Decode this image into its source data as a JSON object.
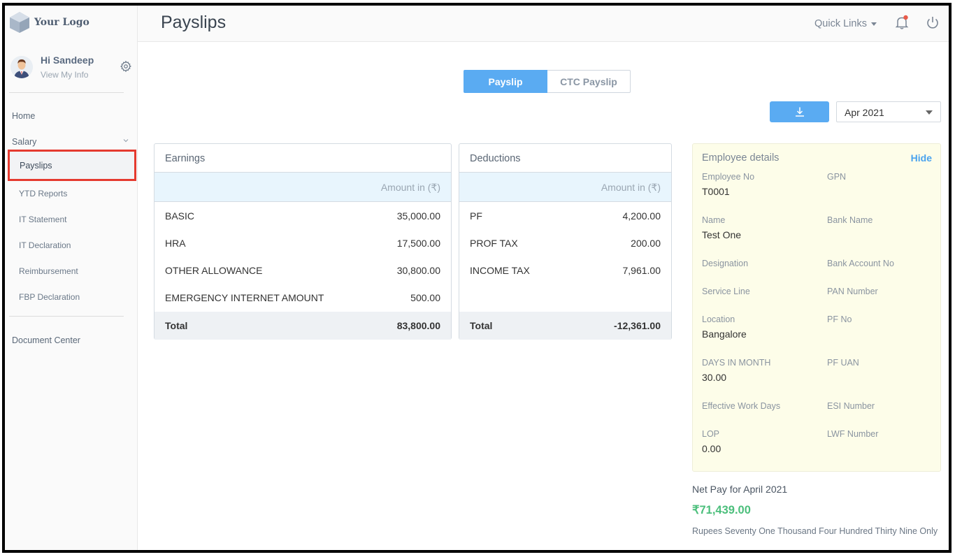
{
  "app": {
    "logo_text": "Your Logo"
  },
  "header": {
    "title": "Payslips",
    "quick_links": "Quick Links"
  },
  "profile": {
    "greeting": "Hi Sandeep",
    "view_info": "View My Info"
  },
  "nav": {
    "home": "Home",
    "salary": "Salary",
    "items": [
      "Payslips",
      "YTD Reports",
      "IT Statement",
      "IT Declaration",
      "Reimbursement",
      "FBP Declaration"
    ],
    "document_center": "Document Center"
  },
  "tabs": {
    "payslip": "Payslip",
    "ctc_payslip": "CTC Payslip"
  },
  "month_select": {
    "value": "Apr 2021"
  },
  "earnings": {
    "title": "Earnings",
    "amount_header": "Amount in (₹)",
    "rows": [
      {
        "label": "BASIC",
        "value": "35,000.00"
      },
      {
        "label": "HRA",
        "value": "17,500.00"
      },
      {
        "label": "OTHER ALLOWANCE",
        "value": "30,800.00"
      },
      {
        "label": "EMERGENCY INTERNET AMOUNT",
        "value": "500.00"
      }
    ],
    "total_label": "Total",
    "total_value": "83,800.00"
  },
  "deductions": {
    "title": "Deductions",
    "amount_header": "Amount in (₹)",
    "rows": [
      {
        "label": "PF",
        "value": "4,200.00"
      },
      {
        "label": "PROF TAX",
        "value": "200.00"
      },
      {
        "label": "INCOME TAX",
        "value": "7,961.00"
      }
    ],
    "total_label": "Total",
    "total_value": "-12,361.00"
  },
  "employee": {
    "title": "Employee details",
    "hide": "Hide",
    "fields": {
      "employee_no": {
        "label": "Employee No",
        "value": "T0001"
      },
      "gpn": {
        "label": "GPN",
        "value": ""
      },
      "name": {
        "label": "Name",
        "value": "Test One"
      },
      "bank_name": {
        "label": "Bank Name",
        "value": ""
      },
      "designation": {
        "label": "Designation",
        "value": ""
      },
      "bank_account_no": {
        "label": "Bank Account No",
        "value": ""
      },
      "service_line": {
        "label": "Service Line",
        "value": ""
      },
      "pan_number": {
        "label": "PAN Number",
        "value": ""
      },
      "location": {
        "label": "Location",
        "value": "Bangalore"
      },
      "pf_no": {
        "label": "PF No",
        "value": ""
      },
      "days_in_month": {
        "label": "DAYS IN MONTH",
        "value": "30.00"
      },
      "pf_uan": {
        "label": "PF UAN",
        "value": ""
      },
      "effective_work_days": {
        "label": "Effective Work Days",
        "value": ""
      },
      "esi_number": {
        "label": "ESI Number",
        "value": ""
      },
      "lop": {
        "label": "LOP",
        "value": "0.00"
      },
      "lwf_number": {
        "label": "LWF Number",
        "value": ""
      }
    }
  },
  "net_pay": {
    "label": "Net Pay for April 2021",
    "amount": "₹71,439.00",
    "words": "Rupees Seventy One Thousand Four Hundred Thirty Nine Only"
  },
  "colors": {
    "accent": "#5aabf2",
    "net_pay_green": "#4cbf7c",
    "employee_panel_bg": "#fdfde9",
    "active_nav_border": "#e53a2f",
    "notification_dot": "#e85b4a"
  },
  "icons": [
    "logo-icon",
    "gear-icon",
    "chevron-down-icon",
    "bell-icon",
    "power-icon",
    "download-icon"
  ]
}
